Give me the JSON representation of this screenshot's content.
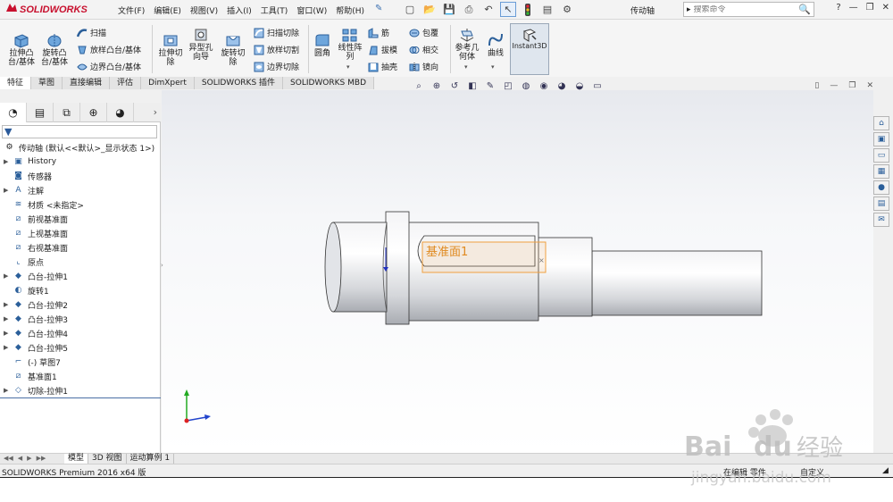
{
  "app": {
    "logo": "SOLIDWORKS",
    "menus": [
      "文件(F)",
      "编辑(E)",
      "视图(V)",
      "插入(I)",
      "工具(T)",
      "窗口(W)",
      "帮助(H)"
    ],
    "document_name": "传动轴",
    "search_placeholder": "搜索命令"
  },
  "ribbon": {
    "extrude_boss": "拉伸凸\n台/基体",
    "revolve_boss": "旋转凸\n台/基体",
    "sweep": "扫描",
    "loft_boss": "放样凸台/基体",
    "boundary_boss": "边界凸台/基体",
    "extrude_cut": "拉伸切\n除",
    "hole_wizard": "异型孔\n向导",
    "revolve_cut": "旋转切\n除",
    "swept_cut": "扫描切除",
    "lofted_cut": "放样切割",
    "boundary_cut": "边界切除",
    "fillet": "圆角",
    "linear_pattern": "线性阵\n列",
    "rib": "筋",
    "draft": "拔模",
    "shell": "抽壳",
    "wrap": "包覆",
    "intersect": "相交",
    "mirror": "镜向",
    "ref_geometry": "参考几\n何体",
    "curves": "曲线",
    "instant3d": "Instant3D"
  },
  "tabs": [
    "特征",
    "草图",
    "直接编辑",
    "评估",
    "DimXpert",
    "SOLIDWORKS 插件",
    "SOLIDWORKS MBD"
  ],
  "tree": {
    "root": "传动轴  (默认<<默认>_显示状态 1>)",
    "items": [
      {
        "label": "History",
        "icon": "history-folder-icon",
        "expand": true
      },
      {
        "label": "传感器",
        "icon": "sensor-icon",
        "expand": false
      },
      {
        "label": "注解",
        "icon": "annotation-icon",
        "expand": true
      },
      {
        "label": "材质 <未指定>",
        "icon": "material-icon",
        "expand": false
      },
      {
        "label": "前视基准面",
        "icon": "plane-icon",
        "expand": false
      },
      {
        "label": "上视基准面",
        "icon": "plane-icon",
        "expand": false
      },
      {
        "label": "右视基准面",
        "icon": "plane-icon",
        "expand": false
      },
      {
        "label": "原点",
        "icon": "origin-icon",
        "expand": false
      },
      {
        "label": "凸台-拉伸1",
        "icon": "extrude-feature-icon",
        "expand": true
      },
      {
        "label": "旋转1",
        "icon": "revolve-feature-icon",
        "expand": false
      },
      {
        "label": "凸台-拉伸2",
        "icon": "extrude-feature-icon",
        "expand": true
      },
      {
        "label": "凸台-拉伸3",
        "icon": "extrude-feature-icon",
        "expand": true
      },
      {
        "label": "凸台-拉伸4",
        "icon": "extrude-feature-icon",
        "expand": true
      },
      {
        "label": "凸台-拉伸5",
        "icon": "extrude-feature-icon",
        "expand": true
      },
      {
        "label": "(-) 草图7",
        "icon": "sketch-icon",
        "expand": false
      },
      {
        "label": "基准面1",
        "icon": "plane-icon",
        "expand": false
      },
      {
        "label": "切除-拉伸1",
        "icon": "cut-feature-icon",
        "expand": true
      }
    ]
  },
  "viewport": {
    "plane_label": "基准面1"
  },
  "bottom_tabs": [
    "模型",
    "3D 视图",
    "运动算例 1"
  ],
  "status": {
    "product": "SOLIDWORKS Premium 2016 x64 版",
    "editing": "在编辑 零件",
    "custom": "自定义"
  },
  "colors": {
    "plane_orange": "#f0a040",
    "accent_blue": "#2b5f9a",
    "logo_red": "#c8102e"
  }
}
